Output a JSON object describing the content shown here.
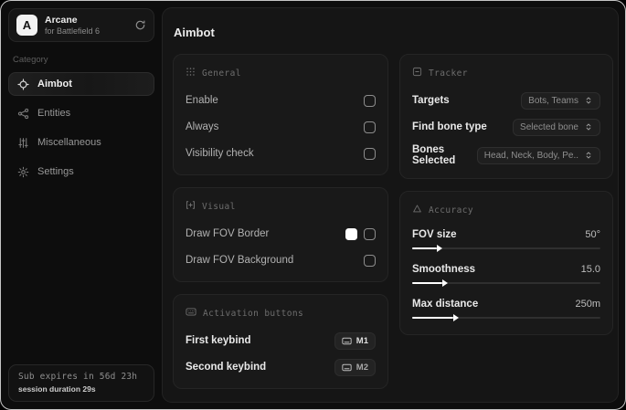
{
  "brand": {
    "logo_letter": "A",
    "title": "Arcane",
    "subtitle": "for Battlefield 6"
  },
  "sidebar": {
    "category_label": "Category",
    "items": [
      {
        "label": "Aimbot",
        "icon": "crosshair-icon",
        "active": true
      },
      {
        "label": "Entities",
        "icon": "entities-icon",
        "active": false
      },
      {
        "label": "Miscellaneous",
        "icon": "sliders-icon",
        "active": false
      },
      {
        "label": "Settings",
        "icon": "gear-icon",
        "active": false
      }
    ],
    "footer": {
      "sub_expires": "Sub expires in 56d 23h",
      "session_duration": "session duration 29s"
    }
  },
  "main": {
    "title": "Aimbot",
    "general": {
      "header": "General",
      "rows": [
        {
          "label": "Enable",
          "checked": false
        },
        {
          "label": "Always",
          "checked": false
        },
        {
          "label": "Visibility check",
          "checked": false
        }
      ]
    },
    "visual": {
      "header": "Visual",
      "rows": [
        {
          "label": "Draw FOV Border",
          "color": "#ffffff",
          "checked": false
        },
        {
          "label": "Draw FOV Background",
          "checked": false
        }
      ]
    },
    "activation": {
      "header": "Activation buttons",
      "rows": [
        {
          "label": "First keybind",
          "key": "M1"
        },
        {
          "label": "Second keybind",
          "key": "M2"
        }
      ]
    },
    "tracker": {
      "header": "Tracker",
      "rows": [
        {
          "label": "Targets",
          "value": "Bots, Teams"
        },
        {
          "label": "Find bone type",
          "value": "Selected bone"
        },
        {
          "label": "Bones Selected",
          "value": "Head, Neck, Body, Pe.."
        }
      ]
    },
    "accuracy": {
      "header": "Accuracy",
      "sliders": [
        {
          "label": "FOV size",
          "value": "50°",
          "percent": 13
        },
        {
          "label": "Smoothness",
          "value": "15.0",
          "percent": 16
        },
        {
          "label": "Max distance",
          "value": "250m",
          "percent": 22
        }
      ]
    }
  },
  "icons": {
    "sync": "circular-refresh-arrow",
    "aimbot": "crosshair",
    "entities": "share-network",
    "miscellaneous": "vertical-sliders",
    "settings": "gear",
    "general": "dot-grid",
    "visual": "fov-brackets",
    "activation": "keyboard",
    "tracker": "box-minus",
    "accuracy": "triangle",
    "dropdown": "unfold-arrows"
  },
  "colors": {
    "window_border": "#e6e6e6",
    "panel_bg": "#151515",
    "card_bg": "#191919",
    "accent_fill": "#ffffff"
  }
}
